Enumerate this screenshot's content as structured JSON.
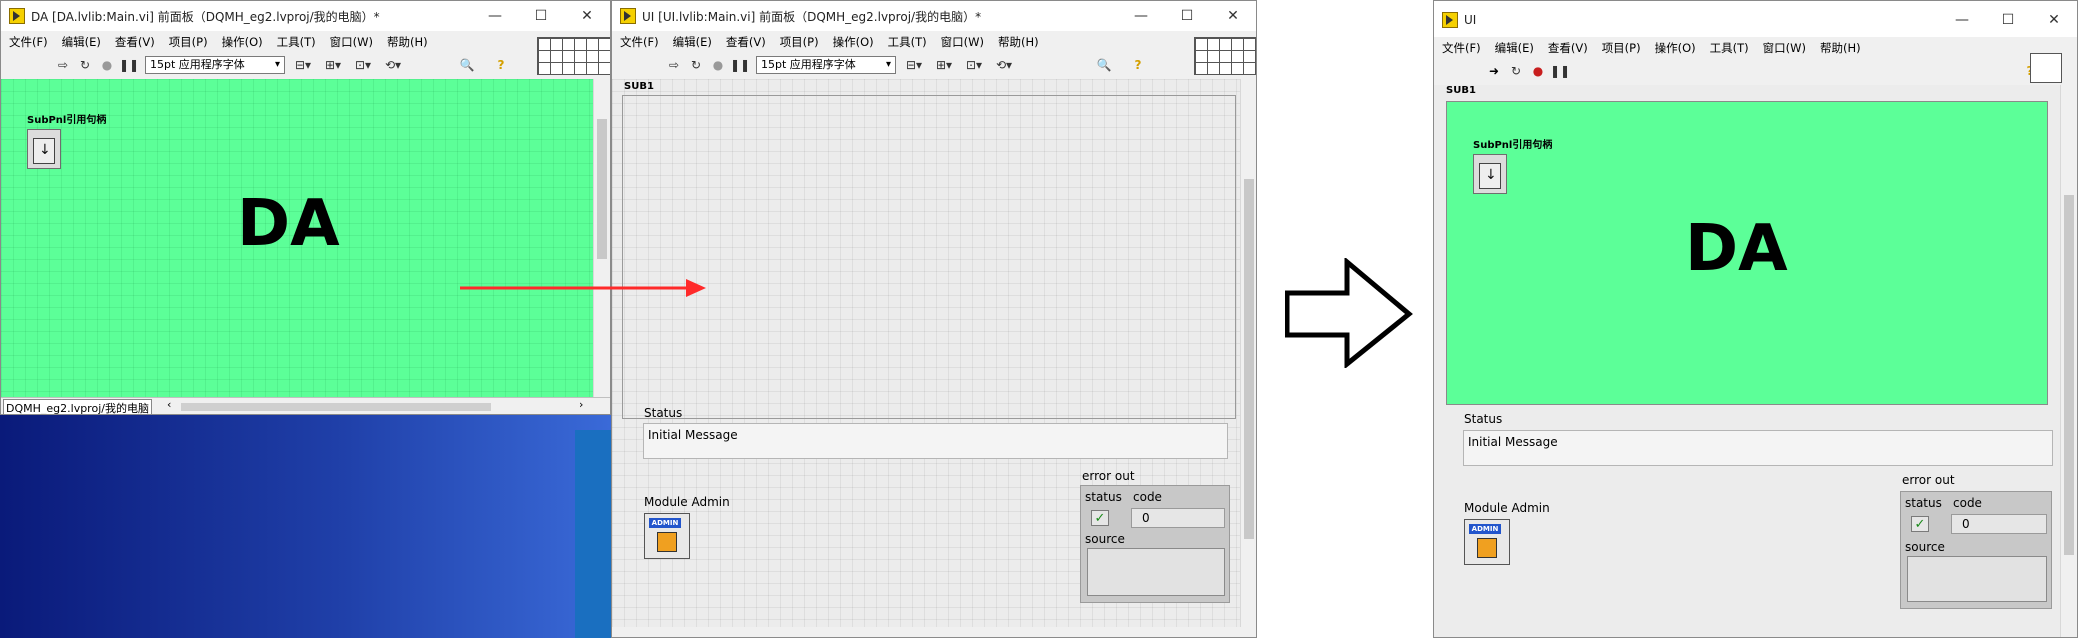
{
  "left_window": {
    "title": "DA [DA.lvlib:Main.vi] 前面板（DQMH_eg2.lvproj/我的电脑）*",
    "menu": [
      "文件(F)",
      "编辑(E)",
      "查看(V)",
      "项目(P)",
      "操作(O)",
      "工具(T)",
      "窗口(W)",
      "帮助(H)"
    ],
    "font_select": "15pt 应用程序字体",
    "subpanel_ref_label": "SubPnl引用句柄",
    "big_text": "DA",
    "status_bar": "DQMH_eg2.lvproj/我的电脑",
    "panel_color": "#5cff98"
  },
  "middle_window": {
    "title": "UI [UI.lvlib:Main.vi] 前面板（DQMH_eg2.lvproj/我的电脑）*",
    "menu": [
      "文件(F)",
      "编辑(E)",
      "查看(V)",
      "项目(P)",
      "操作(O)",
      "工具(T)",
      "窗口(W)",
      "帮助(H)"
    ],
    "font_select": "15pt 应用程序字体",
    "subpanel_label": "SUB1",
    "status_label": "Status",
    "status_value": "Initial Message",
    "module_admin_label": "Module Admin",
    "admin_icon_text": "ADMIN",
    "error_out": {
      "label": "error out",
      "status_label": "status",
      "code_label": "code",
      "code_value": "0",
      "source_label": "source"
    }
  },
  "right_window": {
    "title": "UI",
    "menu": [
      "文件(F)",
      "编辑(E)",
      "查看(V)",
      "项目(P)",
      "操作(O)",
      "工具(T)",
      "窗口(W)",
      "帮助(H)"
    ],
    "subpanel_label": "SUB1",
    "subpanel_ref_label": "SubPnl引用句柄",
    "big_text": "DA",
    "status_label": "Status",
    "status_value": "Initial Message",
    "module_admin_label": "Module Admin",
    "admin_icon_text": "ADMIN",
    "error_out": {
      "label": "error out",
      "status_label": "status",
      "code_label": "code",
      "code_value": "0",
      "source_label": "source"
    },
    "panel_color": "#5cff98"
  },
  "arrow_color": "#ff2a2a",
  "window_controls": [
    "—",
    "☐",
    "✕"
  ]
}
